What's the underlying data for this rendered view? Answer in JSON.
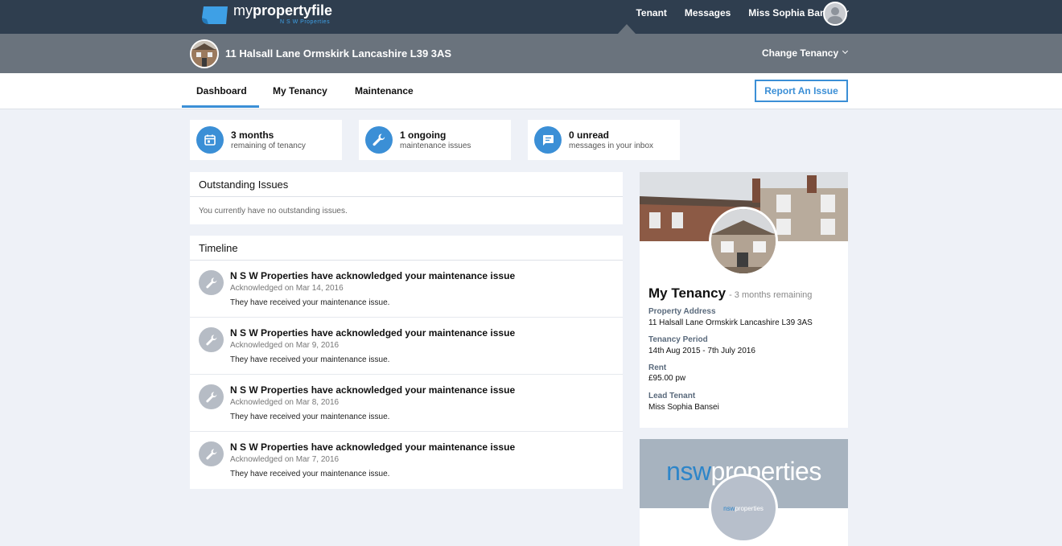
{
  "brand": {
    "name_prefix": "my",
    "name_main": "propertyfile",
    "subtitle": "N S W Properties"
  },
  "topnav": {
    "tenant": "Tenant",
    "messages": "Messages",
    "user_name": "Miss Sophia Bansei"
  },
  "property_bar": {
    "address": "11 Halsall Lane Ormskirk Lancashire L39 3AS",
    "change_tenancy": "Change Tenancy"
  },
  "subnav": {
    "tabs": [
      {
        "label": "Dashboard",
        "active": true
      },
      {
        "label": "My Tenancy",
        "active": false
      },
      {
        "label": "Maintenance",
        "active": false
      }
    ],
    "report_button": "Report An Issue"
  },
  "stats": [
    {
      "title": "3 months",
      "subtitle": "remaining of tenancy",
      "icon": "calendar-icon"
    },
    {
      "title": "1 ongoing",
      "subtitle": "maintenance issues",
      "icon": "wrench-icon"
    },
    {
      "title": "0 unread",
      "subtitle": "messages in your inbox",
      "icon": "message-icon"
    }
  ],
  "outstanding": {
    "title": "Outstanding Issues",
    "empty_text": "You currently have no outstanding issues."
  },
  "timeline": {
    "title": "Timeline",
    "items": [
      {
        "title": "N S W Properties have acknowledged your maintenance issue",
        "date": "Acknowledged on Mar 14, 2016",
        "desc": "They have received your maintenance issue."
      },
      {
        "title": "N S W Properties have acknowledged your maintenance issue",
        "date": "Acknowledged on Mar 9, 2016",
        "desc": "They have received your maintenance issue."
      },
      {
        "title": "N S W Properties have acknowledged your maintenance issue",
        "date": "Acknowledged on Mar 8, 2016",
        "desc": "They have received your maintenance issue."
      },
      {
        "title": "N S W Properties have acknowledged your maintenance issue",
        "date": "Acknowledged on Mar 7, 2016",
        "desc": "They have received your maintenance issue."
      }
    ]
  },
  "tenancy_card": {
    "heading": "My Tenancy",
    "remaining": "- 3 months remaining",
    "fields": [
      {
        "label": "Property Address",
        "value": "11 Halsall Lane Ormskirk Lancashire L39 3AS"
      },
      {
        "label": "Tenancy Period",
        "value": "14th Aug 2015 - 7th July 2016"
      },
      {
        "label": "Rent",
        "value": "£95.00 pw"
      },
      {
        "label": "Lead Tenant",
        "value": "Miss Sophia Bansei"
      }
    ]
  },
  "agency_card": {
    "banner_nsw": "nsw",
    "banner_rest": "properties",
    "logo_nsw": "nsw",
    "logo_rest": "properties"
  },
  "colors": {
    "topbar": "#2f3e4f",
    "property_bar": "#6a737d",
    "accent": "#3b8fd6",
    "background": "#eef1f7"
  }
}
